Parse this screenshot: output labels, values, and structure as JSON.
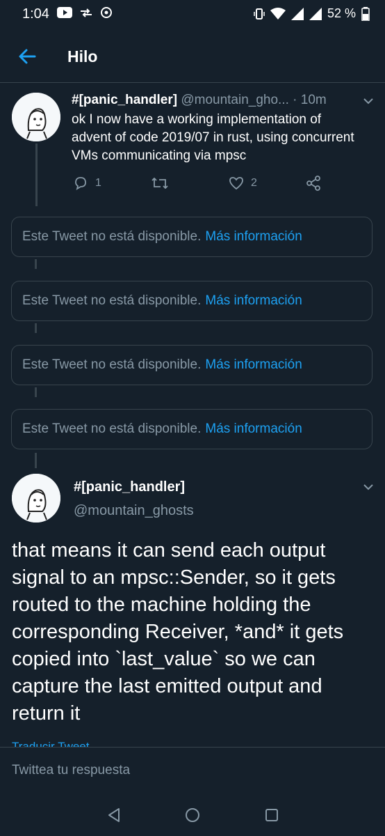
{
  "status_bar": {
    "time": "1:04",
    "battery": "52 %"
  },
  "header": {
    "title": "Hilo"
  },
  "tweet1": {
    "name": "#[panic_handler]",
    "handle": "@mountain_gho...",
    "time": "· 10m",
    "text": "ok I now have a working implementation of advent of code 2019/07 in rust, using concurrent VMs communicating via mpsc",
    "replies": "1",
    "likes": "2"
  },
  "unavailable": [
    {
      "text": "Este Tweet no está disponible.",
      "link": "Más información"
    },
    {
      "text": "Este Tweet no está disponible.",
      "link": "Más información"
    },
    {
      "text": "Este Tweet no está disponible.",
      "link": "Más información"
    },
    {
      "text": "Este Tweet no está disponible.",
      "link": "Más información"
    }
  ],
  "tweet2": {
    "name": "#[panic_handler]",
    "handle": "@mountain_ghosts",
    "text": "that means it can send each output signal to an mpsc::Sender, so it gets routed to the machine holding the corresponding Receiver, *and* it gets copied into `last_value` so we can capture the last emitted output and return it",
    "translate": "Traducir Tweet"
  },
  "composer": {
    "placeholder": "Twittea tu respuesta"
  },
  "colors": {
    "background": "#15202b",
    "accent": "#1da1f2",
    "muted": "#8899a6",
    "border": "#38444d"
  }
}
